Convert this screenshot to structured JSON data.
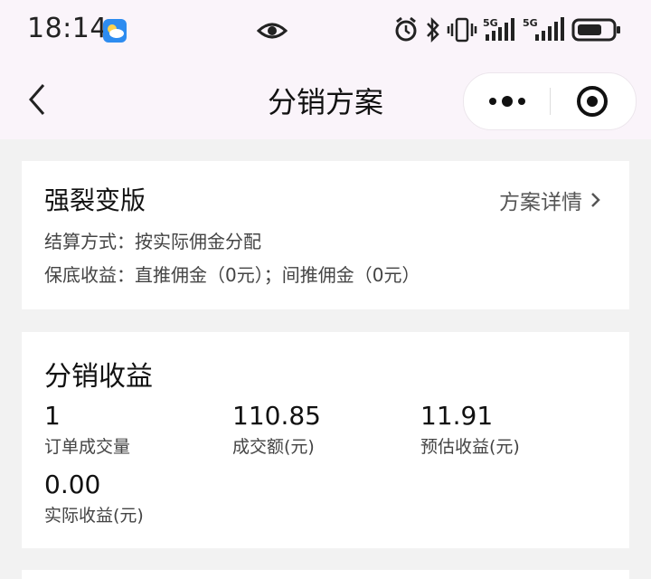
{
  "status_bar": {
    "time": "18:14",
    "signal1": "5G",
    "signal2": "5G"
  },
  "nav": {
    "title": "分销方案"
  },
  "plan": {
    "name": "强裂变版",
    "detail_link": "方案详情",
    "settlement": "结算方式：按实际佣金分配",
    "guarantee": "保底收益：直推佣金（0元）；间推佣金（0元）"
  },
  "earnings": {
    "title": "分销收益",
    "stats": [
      {
        "value": "1",
        "label": "订单成交量"
      },
      {
        "value": "110.85",
        "label": "成交额(元)"
      },
      {
        "value": "11.91",
        "label": "预估收益(元)"
      },
      {
        "value": "0.00",
        "label": "实际收益(元)"
      }
    ]
  }
}
